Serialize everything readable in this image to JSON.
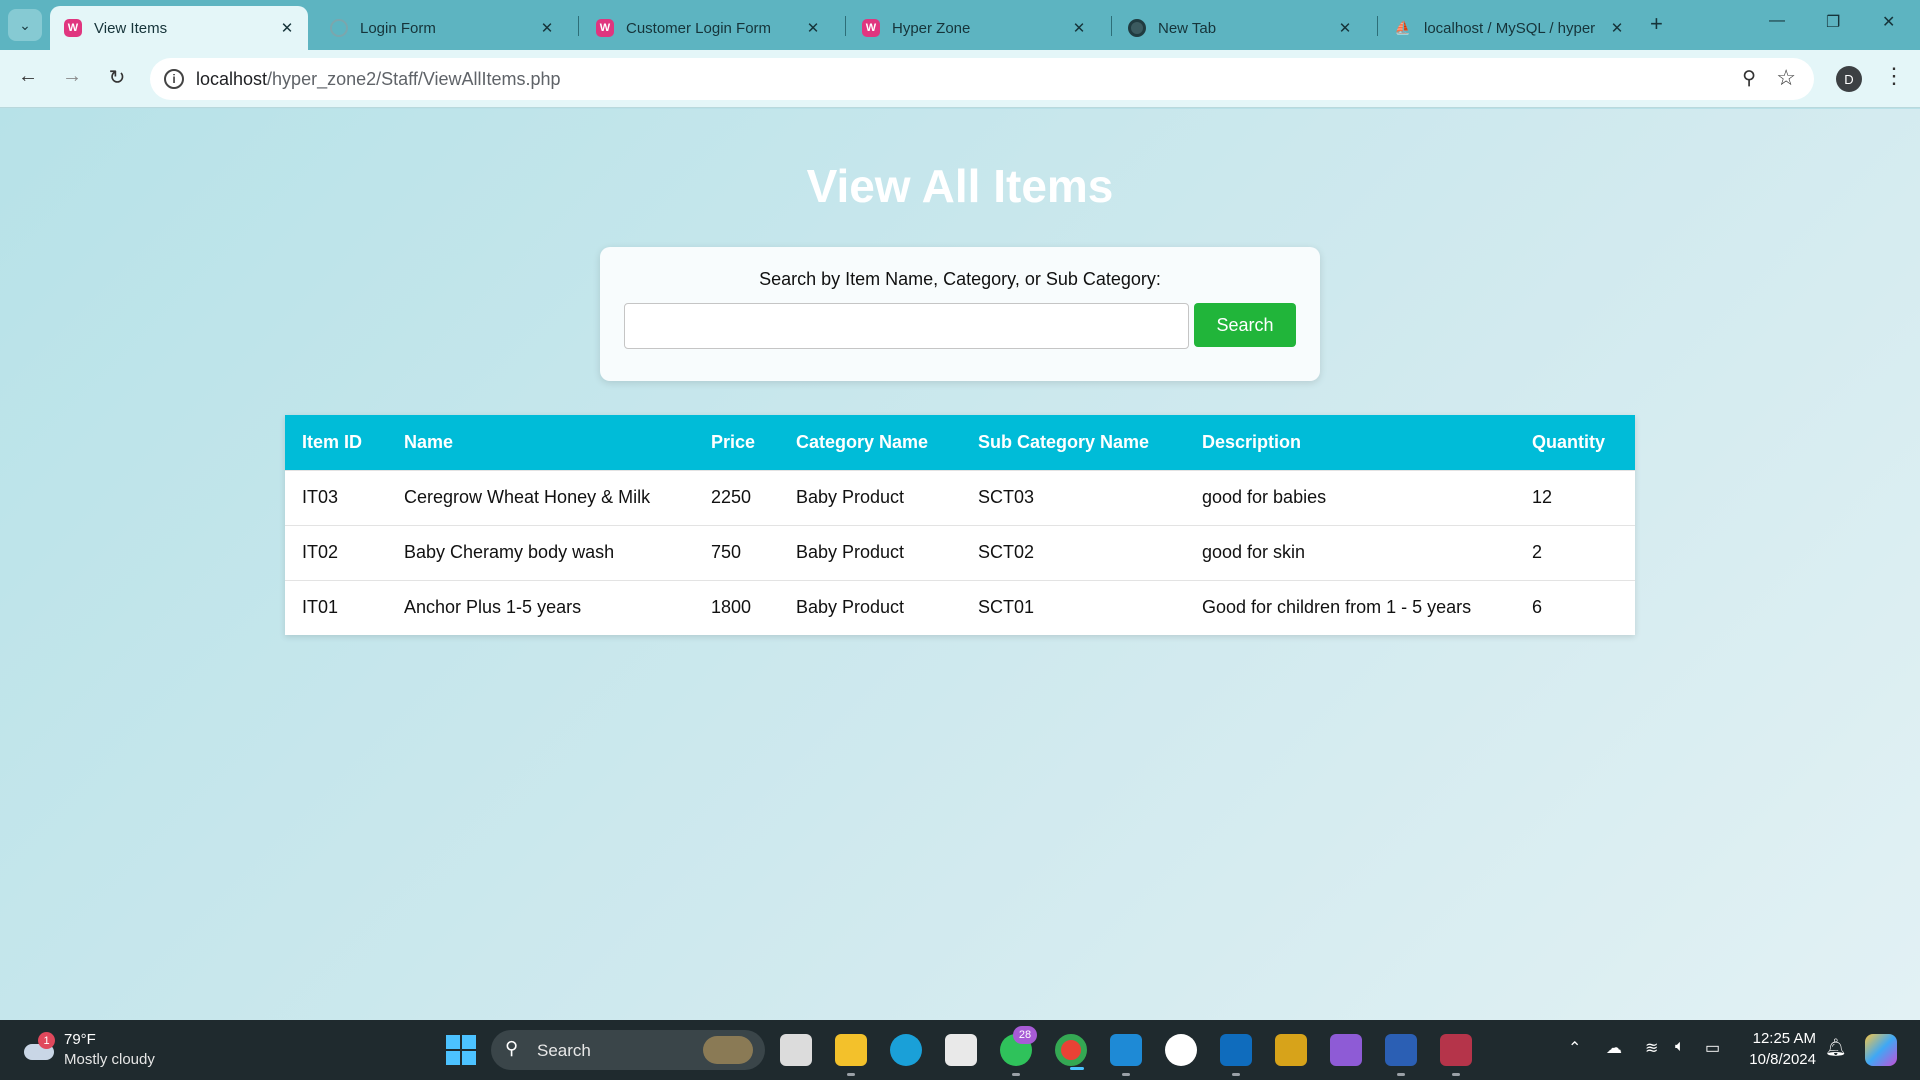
{
  "browser": {
    "tabs": [
      {
        "title": "View Items",
        "favicon": "wamp-icon",
        "active": true
      },
      {
        "title": "Login Form",
        "favicon": "globe-icon",
        "active": false
      },
      {
        "title": "Customer Login Form",
        "favicon": "wamp-icon",
        "active": false
      },
      {
        "title": "Hyper Zone",
        "favicon": "wamp-icon",
        "active": false
      },
      {
        "title": "New Tab",
        "favicon": "chrome-icon",
        "active": false
      },
      {
        "title": "localhost / MySQL / hyper",
        "favicon": "phpmyadmin-icon",
        "active": false
      }
    ],
    "url_host": "localhost",
    "url_path": "/hyper_zone2/Staff/ViewAllItems.php",
    "profile_initial": "D"
  },
  "page": {
    "title": "View All Items",
    "search": {
      "label": "Search by Item Name, Category, or Sub Category:",
      "value": "",
      "button_label": "Search"
    },
    "table": {
      "headers": [
        "Item ID",
        "Name",
        "Price",
        "Category Name",
        "Sub Category Name",
        "Description",
        "Quantity"
      ],
      "rows": [
        [
          "IT03",
          "Ceregrow Wheat Honey & Milk",
          "2250",
          "Baby Product",
          "SCT03",
          "good for babies",
          "12"
        ],
        [
          "IT02",
          "Baby Cheramy body wash",
          "750",
          "Baby Product",
          "SCT02",
          "good for skin",
          "2"
        ],
        [
          "IT01",
          "Anchor Plus 1-5 years",
          "1800",
          "Baby Product",
          "SCT01",
          "Good for children from 1 - 5 years",
          "6"
        ]
      ]
    },
    "colors": {
      "header_bg": "#00bcd8",
      "search_button_bg": "#21b53a",
      "tab_strip_bg": "#5db4c1"
    }
  },
  "taskbar": {
    "weather": {
      "badge": "1",
      "temp": "79°F",
      "desc": "Mostly cloudy"
    },
    "search_label": "Search",
    "whatsapp_badge": "28",
    "chrome_profile_badge": "D",
    "clock": {
      "time": "12:25 AM",
      "date": "10/8/2024"
    }
  }
}
